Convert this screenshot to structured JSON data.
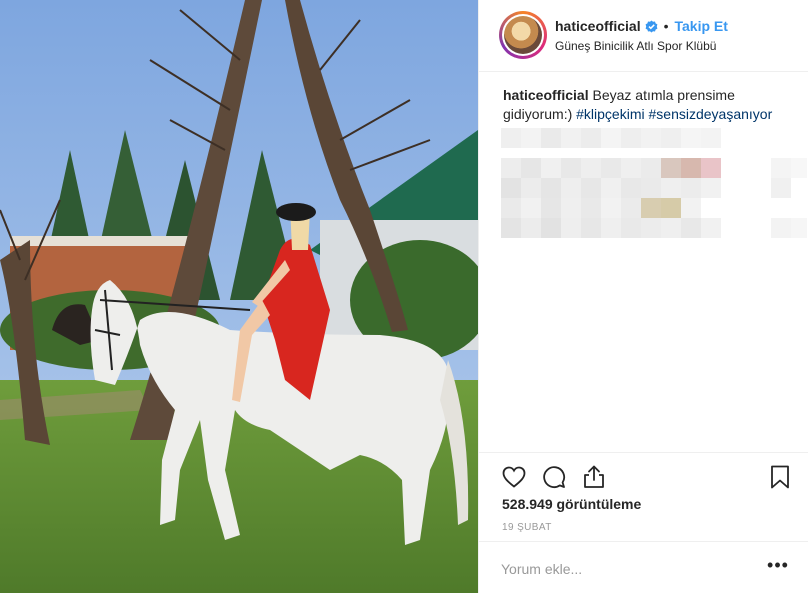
{
  "post": {
    "username": "haticeofficial",
    "follow_label": "Takip Et",
    "separator": "•",
    "location": "Güneş Binicilik Atlı Spor Klübü",
    "caption": {
      "username": "haticeofficial",
      "text": "Beyaz atımla prensime gidiyorum:)",
      "hashtags": [
        "#klipçekimi",
        "#sensizdeyaşanıyor"
      ]
    },
    "views": "528.949 görüntüleme",
    "date": "19 ŞUBAT",
    "comment_placeholder": "Yorum ekle...",
    "more_label": "•••"
  },
  "icons": {
    "verified": "verified-badge-icon",
    "like": "heart-icon",
    "comment": "comment-bubble-icon",
    "share": "share-icon",
    "save": "bookmark-icon",
    "more": "more-options-icon"
  },
  "colors": {
    "link_blue": "#3897f0",
    "hashtag": "#003569",
    "muted": "#999999",
    "border": "#efefef"
  }
}
